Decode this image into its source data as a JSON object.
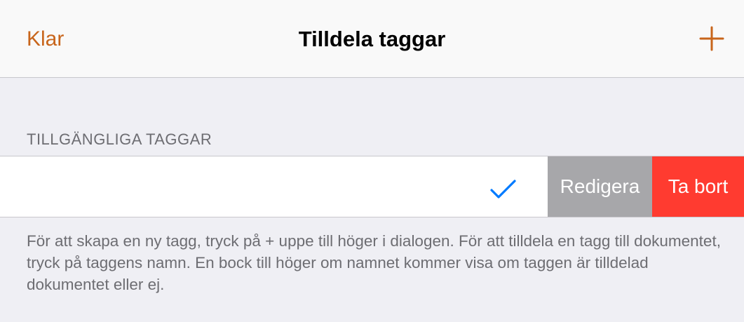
{
  "navbar": {
    "done_label": "Klar",
    "title": "Tilldela taggar",
    "add_icon": "plus-icon"
  },
  "section": {
    "header": "TILLGÄNGLIGA TAGGAR",
    "row": {
      "checked": true,
      "check_icon": "checkmark-icon",
      "edit_label": "Redigera",
      "delete_label": "Ta bort"
    },
    "footer": "För att skapa en ny tagg, tryck på + uppe till höger i dialogen. För att tilldela en tagg till dokumentet, tryck på taggens namn. En bock till höger om namnet kommer visa om taggen är tilldelad dokumentet eller ej."
  },
  "colors": {
    "accent": "#c8651b",
    "checkmark": "#007aff",
    "edit_bg": "#a7a7aa",
    "delete_bg": "#ff3b30",
    "background": "#efeff4"
  }
}
